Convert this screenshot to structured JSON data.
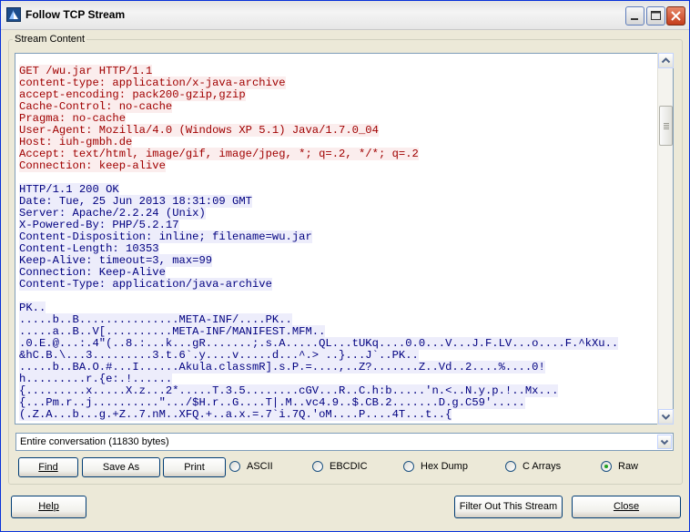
{
  "window": {
    "title": "Follow TCP Stream"
  },
  "group": {
    "label": "Stream Content"
  },
  "stream": {
    "request_lines": [
      "GET /wu.jar HTTP/1.1",
      "content-type: application/x-java-archive",
      "accept-encoding: pack200-gzip,gzip",
      "Cache-Control: no-cache",
      "Pragma: no-cache",
      "User-Agent: Mozilla/4.0 (Windows XP 5.1) Java/1.7.0_04",
      "Host: iuh-gmbh.de",
      "Accept: text/html, image/gif, image/jpeg, *; q=.2, */*; q=.2",
      "Connection: keep-alive"
    ],
    "response_lines": [
      "HTTP/1.1 200 OK",
      "Date: Tue, 25 Jun 2013 18:31:09 GMT",
      "Server: Apache/2.2.24 (Unix)",
      "X-Powered-By: PHP/5.2.17",
      "Content-Disposition: inline; filename=wu.jar",
      "Content-Length: 10353",
      "Keep-Alive: timeout=3, max=99",
      "Connection: Keep-Alive",
      "Content-Type: application/java-archive"
    ],
    "binary_lines": [
      "PK..",
      ".....b..B...............META-INF/....PK..",
      ".....a..B..V[..........META-INF/MANIFEST.MFM..",
      ".0.E.@...:.4\"(..8.:...k...gR.......;.s.A.....QL...tUKq....0.0...V...J.F.LV...o....F.^kXu..",
      "&hC.B.\\...3.........3.t.6`.y....v.....d...^.> ..}...J`..PK..",
      ".....b..BA.O.#...I......Akula.classmR].s.P.=....,..Z?.......Z..Vd..2....%....0!",
      "h.........r.{e:.!......",
      "{.........x.....X.z...2*.....T.3.5........cGV...R..C.h:b.....'n.<..N.y.p.!..Mx...",
      "{...Pm.r..j..........\".../$H.r..G....T|.M..vc4.9..$.CB.2.......D.g.C59'.....",
      "(.Z.A...b...g.+Z..7.nM..XFQ.+..a.x.=.7`i.7Q.'oM....P....4T...t..{"
    ]
  },
  "conversation_select": {
    "value": "Entire conversation (11830 bytes)"
  },
  "buttons": {
    "find": "Find",
    "save_as": "Save As",
    "print": "Print",
    "help": "Help",
    "filter_out": "Filter Out This Stream",
    "close": "Close"
  },
  "encodings": {
    "selected": "Raw",
    "options": [
      "ASCII",
      "EBCDIC",
      "Hex Dump",
      "C Arrays",
      "Raw"
    ]
  },
  "colors": {
    "request_text": "#a00000",
    "request_bg": "#fbeded",
    "response_text": "#000080",
    "response_bg": "#ededfb"
  }
}
